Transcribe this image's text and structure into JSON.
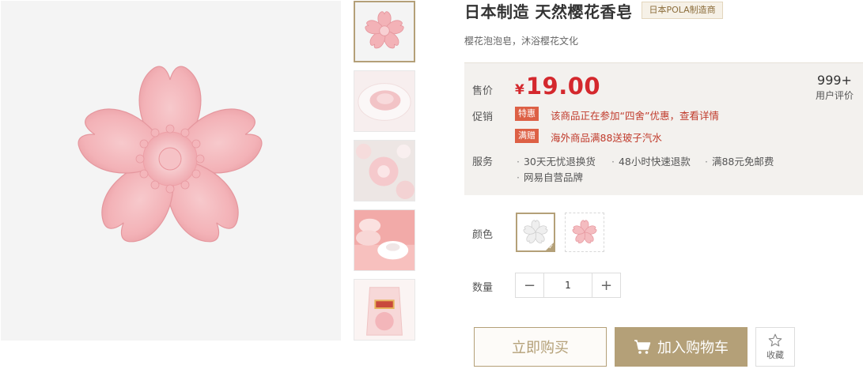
{
  "product": {
    "title": "日本制造 天然樱花香皂",
    "brand_tag": "日本POLA制造商",
    "subtitle": "樱花泡泡皂，沐浴樱花文化"
  },
  "gallery": {
    "main_image": "pink-sakura-soap",
    "thumbnails": [
      "sakura-soap-pink",
      "sakura-soap-on-dish",
      "sakura-soap-white-top",
      "sakura-soaps-stacked",
      "sakura-soap-gift-bag"
    ],
    "active_index": 0
  },
  "price_box": {
    "price_label": "售价",
    "currency": "¥",
    "price": "19.00",
    "review_count": "999+",
    "review_label": "用户评价",
    "promo_label": "促销",
    "promos": [
      {
        "badge": "特惠",
        "text": "该商品正在参加“四舍”优惠，查看详情"
      },
      {
        "badge": "满赠",
        "text": "海外商品满88送玻子汽水"
      }
    ],
    "service_label": "服务",
    "services": [
      "30天无忧退换货",
      "48小时快速退款",
      "满88元免邮费",
      "网易自营品牌"
    ]
  },
  "options": {
    "color_label": "颜色",
    "colors": [
      "white",
      "pink"
    ],
    "selected_color_index": 0,
    "quantity_label": "数量",
    "quantity": "1",
    "minus": "−",
    "plus": "+"
  },
  "actions": {
    "buy_now": "立即购买",
    "add_to_cart": "加入购物车",
    "favorite": "收藏"
  },
  "colors": {
    "accent": "#b4a078",
    "price_red": "#d4282d",
    "promo_badge": "#dd6045",
    "price_box_bg": "#f3f1ee"
  }
}
